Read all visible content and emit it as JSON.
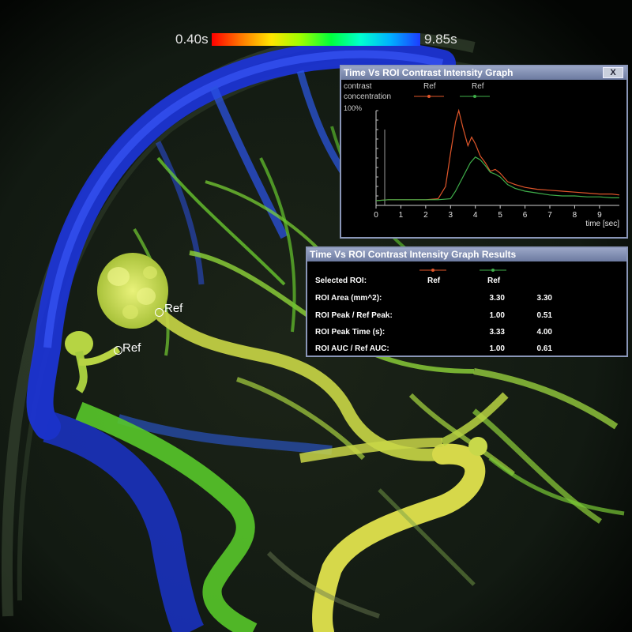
{
  "colorbar": {
    "min_label": "0.40s",
    "max_label": "9.85s"
  },
  "markers": [
    {
      "label": "Ref"
    },
    {
      "label": "Ref"
    }
  ],
  "graph_window": {
    "title": "Time Vs ROI Contrast Intensity Graph",
    "close_label": "X",
    "legend_title_1": "contrast",
    "legend_title_2": "concentration",
    "legend": [
      {
        "name": "Ref",
        "color": "#e0562a"
      },
      {
        "name": "Ref",
        "color": "#3fae4a"
      }
    ],
    "y_top_label": "100%",
    "x_axis_label": "time [sec]"
  },
  "chart_data": {
    "type": "line",
    "title": "Time Vs ROI Contrast Intensity Graph",
    "xlabel": "time [sec]",
    "ylabel": "contrast concentration",
    "xlim": [
      0,
      9.8
    ],
    "ylim": [
      0,
      100
    ],
    "x_ticks": [
      "0",
      "1",
      "2",
      "3",
      "4",
      "5",
      "6",
      "7",
      "8",
      "9"
    ],
    "series": [
      {
        "name": "Ref",
        "color": "#e0562a",
        "x": [
          0,
          0.5,
          1,
          1.5,
          2,
          2.5,
          2.8,
          3,
          3.2,
          3.33,
          3.5,
          3.7,
          3.85,
          4,
          4.2,
          4.4,
          4.6,
          4.8,
          5,
          5.3,
          5.6,
          6,
          6.5,
          7,
          7.5,
          8,
          8.5,
          9,
          9.5,
          9.8
        ],
        "y": [
          5,
          6,
          6,
          6,
          6,
          7,
          20,
          55,
          88,
          100,
          82,
          63,
          72,
          65,
          52,
          45,
          36,
          38,
          34,
          25,
          22,
          19,
          17,
          16,
          15,
          14,
          13,
          12,
          12,
          11
        ]
      },
      {
        "name": "Ref",
        "color": "#3fae4a",
        "x": [
          0,
          0.5,
          1,
          1.5,
          2,
          2.5,
          3,
          3.2,
          3.5,
          3.8,
          4,
          4.2,
          4.4,
          4.6,
          4.8,
          5,
          5.3,
          5.6,
          6,
          6.5,
          7,
          7.5,
          8,
          8.5,
          9,
          9.5,
          9.8
        ],
        "y": [
          5,
          6,
          6,
          6,
          6,
          6,
          7,
          15,
          30,
          45,
          51,
          48,
          42,
          35,
          33,
          30,
          22,
          18,
          15,
          13,
          11,
          10,
          10,
          9,
          9,
          8,
          8
        ]
      }
    ]
  },
  "results_window": {
    "title": "Time Vs ROI Contrast Intensity Graph Results",
    "header_label": "Selected ROI:",
    "col1": "Ref",
    "col2": "Ref",
    "col1_color": "#e0562a",
    "col2_color": "#3fae4a",
    "rows": [
      {
        "label": "ROI Area (mm^2):",
        "v1": "3.30",
        "v2": "3.30"
      },
      {
        "label": "ROI Peak / Ref Peak:",
        "v1": "1.00",
        "v2": "0.51"
      },
      {
        "label": "ROI Peak Time (s):",
        "v1": "3.33",
        "v2": "4.00"
      },
      {
        "label": "ROI AUC / Ref AUC:",
        "v1": "1.00",
        "v2": "0.61"
      }
    ]
  }
}
